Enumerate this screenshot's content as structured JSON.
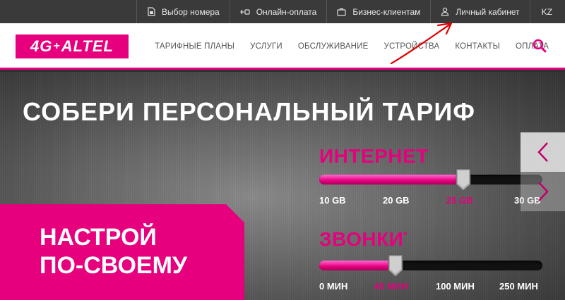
{
  "topbar": {
    "items": [
      {
        "label": "Выбор номера",
        "icon": "sim-card-icon"
      },
      {
        "label": "Онлайн-оплата",
        "icon": "payment-icon"
      },
      {
        "label": "Бизнес-клиентам",
        "icon": "briefcase-icon"
      },
      {
        "label": "Личный кабинет",
        "icon": "user-icon"
      }
    ],
    "lang": "KZ"
  },
  "header": {
    "logo_text": "4G",
    "logo_plus": "+",
    "logo_brand": "ALTEL",
    "nav": [
      "ТАРИФНЫЕ ПЛАНЫ",
      "УСЛУГИ",
      "ОБСЛУЖИВАНИЕ",
      "УСТРОЙСТВА",
      "КОНТАКТЫ",
      "ОПЛАТА"
    ]
  },
  "hero": {
    "title": "СОБЕРИ ПЕРСОНАЛЬНЫЙ ТАРИФ",
    "banner_line1": "НАСТРОЙ",
    "banner_line2": "ПО-СВОЕМУ"
  },
  "internet": {
    "label": "ИНТЕРНЕТ",
    "ticks": [
      "10 GB",
      "20 GB",
      "25 GB",
      "30 GB"
    ],
    "selected": "25 GB",
    "level": 0.64
  },
  "calls": {
    "label": "ЗВОНКИ",
    "footnote": "*",
    "ticks": [
      "0 МИН",
      "40 МИН",
      "100 МИН",
      "250 МИН"
    ],
    "selected": "40 МИН",
    "level": 0.33
  },
  "colors": {
    "accent": "#e6007e",
    "topbar": "#3a3a3a"
  }
}
